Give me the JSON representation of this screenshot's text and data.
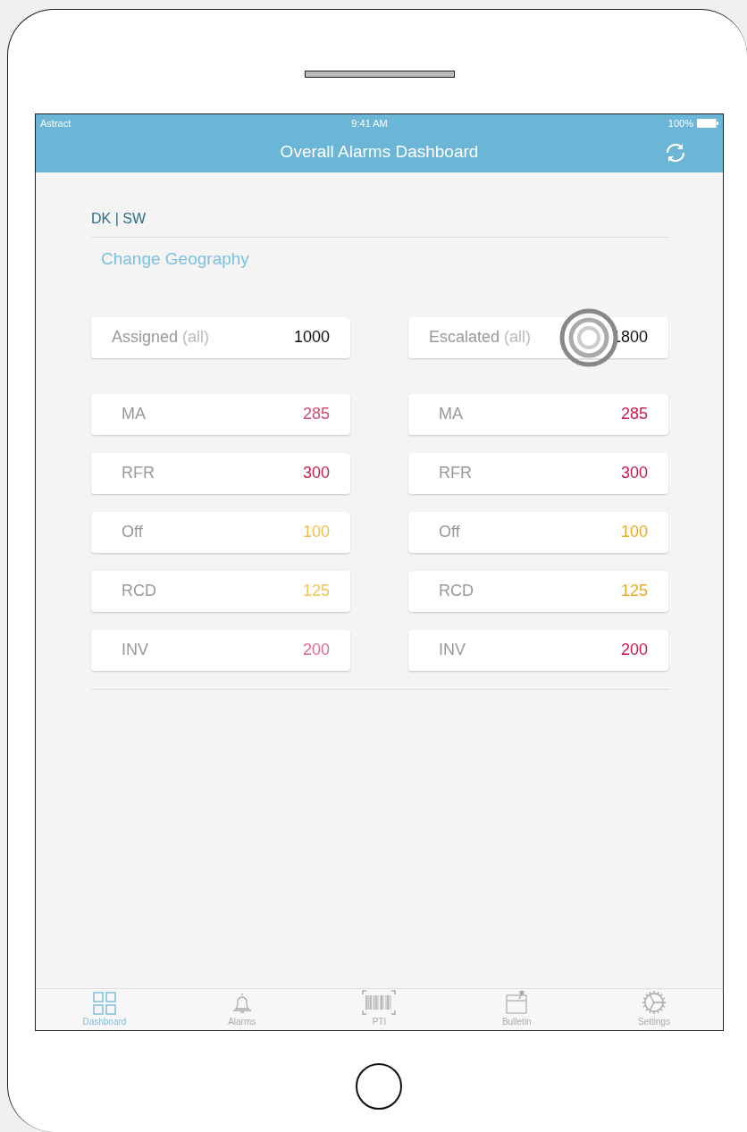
{
  "status_bar": {
    "carrier": "Astract",
    "time": "9:41 AM",
    "battery": "100%"
  },
  "nav_bar": {
    "title": "Overall  Alarms Dashboard"
  },
  "region": {
    "label": "DK | SW"
  },
  "change_link": "Change Geography",
  "columns": [
    {
      "total": {
        "label": "Assigned",
        "qualifier": "(all)",
        "value": "1000"
      },
      "rows": [
        {
          "label": "MA",
          "value": "285",
          "color": "#d24a70"
        },
        {
          "label": "RFR",
          "value": "300",
          "color": "#c8244f"
        },
        {
          "label": "Off",
          "value": "100",
          "color": "#f2be4a"
        },
        {
          "label": "RCD",
          "value": "125",
          "color": "#f2c45c"
        },
        {
          "label": "INV",
          "value": "200",
          "color": "#dc6e8c"
        }
      ]
    },
    {
      "total": {
        "label": "Escalated",
        "qualifier": "(all)",
        "value": "1800"
      },
      "rows": [
        {
          "label": "MA",
          "value": "285",
          "color": "#c81a4a"
        },
        {
          "label": "RFR",
          "value": "300",
          "color": "#c81a4a"
        },
        {
          "label": "Off",
          "value": "100",
          "color": "#eeaa20"
        },
        {
          "label": "RCD",
          "value": "125",
          "color": "#eeaa20"
        },
        {
          "label": "INV",
          "value": "200",
          "color": "#c81a4a"
        }
      ]
    }
  ],
  "tabs": [
    {
      "label": "Dashboard",
      "kind": "grid",
      "selected": true
    },
    {
      "label": "Alarms",
      "kind": "bell",
      "selected": false
    },
    {
      "label": "PTI",
      "kind": "barcode",
      "selected": false
    },
    {
      "label": "Bulletin",
      "kind": "board",
      "selected": false
    },
    {
      "label": "Settings",
      "kind": "gear",
      "selected": false
    }
  ]
}
